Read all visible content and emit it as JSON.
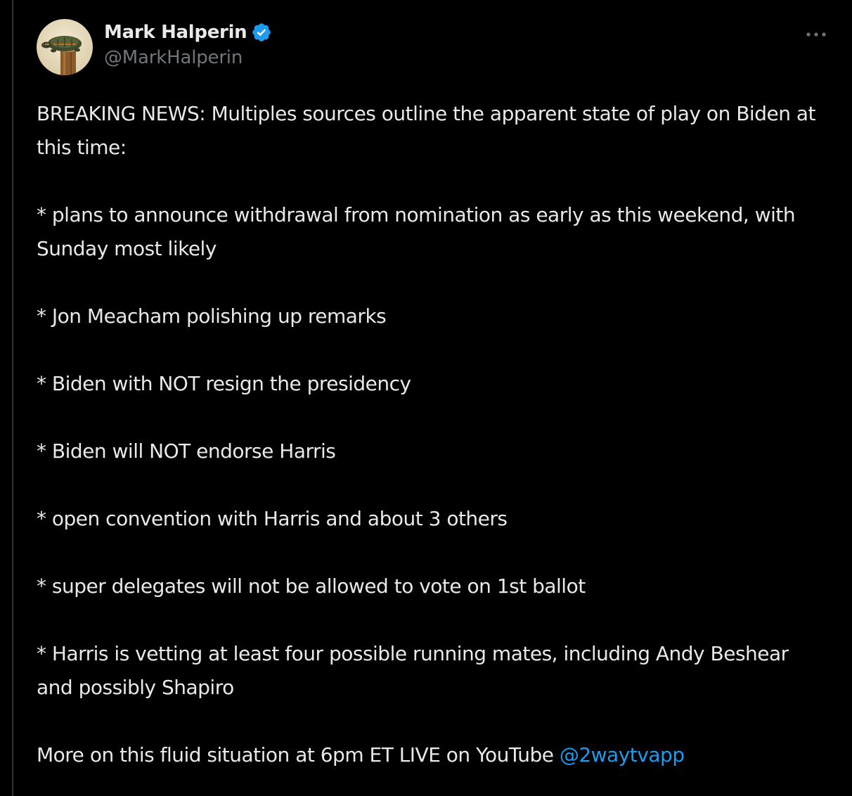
{
  "author": {
    "display_name": "Mark Halperin",
    "handle": "@MarkHalperin",
    "verified": true,
    "avatar_icon": "avatar-photo"
  },
  "menu": {
    "icon": "more-options-icon"
  },
  "tweet": {
    "paragraphs": [
      "BREAKING NEWS: Multiples sources outline the apparent state of play on Biden at this time:",
      "* plans to announce withdrawal from nomination as early as this weekend, with Sunday most likely",
      "* Jon Meacham polishing up remarks",
      "* Biden with NOT resign the presidency",
      "* Biden will NOT endorse Harris",
      "* open convention with Harris and about 3 others",
      "* super delegates will not be allowed to vote on 1st ballot",
      "* Harris is vetting at least four possible running mates, including Andy Beshear and possibly Shapiro"
    ],
    "final_line": {
      "text": "More on this fluid situation at 6pm ET LIVE on YouTube ",
      "mention": "@2waytvapp"
    }
  },
  "colors": {
    "background": "#000000",
    "text": "#e7e9ea",
    "secondary_text": "#71767b",
    "link": "#1d9bf0",
    "verified_badge": "#1d9bf0",
    "divider": "#2f3336"
  }
}
